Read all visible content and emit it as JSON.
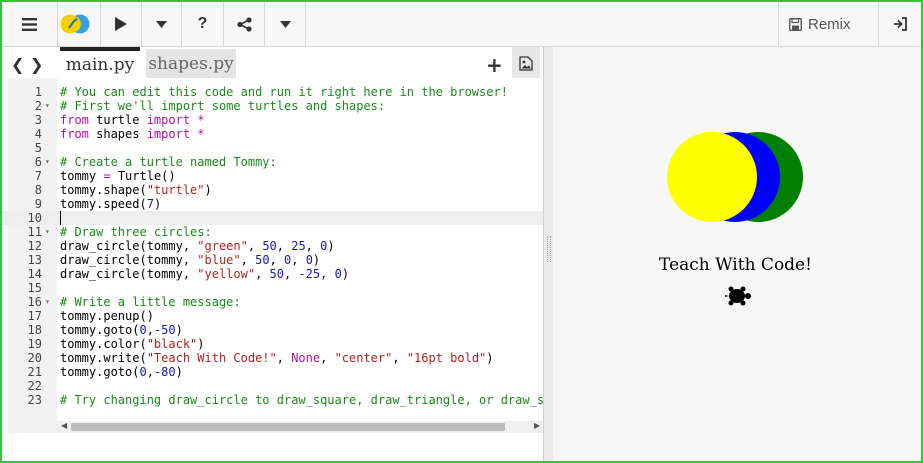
{
  "toolbar": {
    "menu_icon": "hamburger-icon",
    "logo_icon": "python-logo-icon",
    "run_icon": "play-icon",
    "run_dropdown_icon": "caret-down-icon",
    "help_icon": "question-icon",
    "share_icon": "share-icon",
    "share_dropdown_icon": "caret-down-icon",
    "remix_label": "Remix",
    "remix_icon": "save-icon",
    "signin_icon": "sign-in-icon"
  },
  "editor": {
    "tabs": [
      {
        "label": "main.py",
        "active": true
      },
      {
        "label": "shapes.py",
        "active": false
      }
    ],
    "current_line": 10,
    "lines": [
      {
        "num": "1",
        "fold": false,
        "tokens": [
          [
            "c",
            "# You can edit this code and run it right here in the browser!"
          ]
        ]
      },
      {
        "num": "2",
        "fold": true,
        "tokens": [
          [
            "c",
            "# First we'll import some turtles and shapes:"
          ]
        ]
      },
      {
        "num": "3",
        "fold": false,
        "tokens": [
          [
            "k",
            "from"
          ],
          [
            "t",
            " turtle "
          ],
          [
            "k",
            "import"
          ],
          [
            "t",
            " "
          ],
          [
            "k",
            "*"
          ]
        ]
      },
      {
        "num": "4",
        "fold": false,
        "tokens": [
          [
            "k",
            "from"
          ],
          [
            "t",
            " shapes "
          ],
          [
            "k",
            "import"
          ],
          [
            "t",
            " "
          ],
          [
            "k",
            "*"
          ]
        ]
      },
      {
        "num": "5",
        "fold": false,
        "tokens": []
      },
      {
        "num": "6",
        "fold": true,
        "tokens": [
          [
            "c",
            "# Create a turtle named Tommy:"
          ]
        ]
      },
      {
        "num": "7",
        "fold": false,
        "tokens": [
          [
            "t",
            "tommy "
          ],
          [
            "k",
            "="
          ],
          [
            "t",
            " Turtle()"
          ]
        ]
      },
      {
        "num": "8",
        "fold": false,
        "tokens": [
          [
            "t",
            "tommy.shape("
          ],
          [
            "s",
            "\"turtle\""
          ],
          [
            "t",
            ")"
          ]
        ]
      },
      {
        "num": "9",
        "fold": false,
        "tokens": [
          [
            "t",
            "tommy.speed("
          ],
          [
            "n",
            "7"
          ],
          [
            "t",
            ")"
          ]
        ]
      },
      {
        "num": "10",
        "fold": false,
        "tokens": []
      },
      {
        "num": "11",
        "fold": true,
        "tokens": [
          [
            "c",
            "# Draw three circles:"
          ]
        ]
      },
      {
        "num": "12",
        "fold": false,
        "tokens": [
          [
            "t",
            "draw_circle(tommy, "
          ],
          [
            "s",
            "\"green\""
          ],
          [
            "t",
            ", "
          ],
          [
            "n",
            "50"
          ],
          [
            "t",
            ", "
          ],
          [
            "n",
            "25"
          ],
          [
            "t",
            ", "
          ],
          [
            "n",
            "0"
          ],
          [
            "t",
            ")"
          ]
        ]
      },
      {
        "num": "13",
        "fold": false,
        "tokens": [
          [
            "t",
            "draw_circle(tommy, "
          ],
          [
            "s",
            "\"blue\""
          ],
          [
            "t",
            ", "
          ],
          [
            "n",
            "50"
          ],
          [
            "t",
            ", "
          ],
          [
            "n",
            "0"
          ],
          [
            "t",
            ", "
          ],
          [
            "n",
            "0"
          ],
          [
            "t",
            ")"
          ]
        ]
      },
      {
        "num": "14",
        "fold": false,
        "tokens": [
          [
            "t",
            "draw_circle(tommy, "
          ],
          [
            "s",
            "\"yellow\""
          ],
          [
            "t",
            ", "
          ],
          [
            "n",
            "50"
          ],
          [
            "t",
            ", "
          ],
          [
            "n",
            "-25"
          ],
          [
            "t",
            ", "
          ],
          [
            "n",
            "0"
          ],
          [
            "t",
            ")"
          ]
        ]
      },
      {
        "num": "15",
        "fold": false,
        "tokens": []
      },
      {
        "num": "16",
        "fold": true,
        "tokens": [
          [
            "c",
            "# Write a little message:"
          ]
        ]
      },
      {
        "num": "17",
        "fold": false,
        "tokens": [
          [
            "t",
            "tommy.penup()"
          ]
        ]
      },
      {
        "num": "18",
        "fold": false,
        "tokens": [
          [
            "t",
            "tommy.goto("
          ],
          [
            "n",
            "0"
          ],
          [
            "t",
            ","
          ],
          [
            "n",
            "-50"
          ],
          [
            "t",
            ")"
          ]
        ]
      },
      {
        "num": "19",
        "fold": false,
        "tokens": [
          [
            "t",
            "tommy.color("
          ],
          [
            "s",
            "\"black\""
          ],
          [
            "t",
            ")"
          ]
        ]
      },
      {
        "num": "20",
        "fold": false,
        "tokens": [
          [
            "t",
            "tommy.write("
          ],
          [
            "s",
            "\"Teach With Code!\""
          ],
          [
            "t",
            ", "
          ],
          [
            "k",
            "None"
          ],
          [
            "t",
            ", "
          ],
          [
            "s",
            "\"center\""
          ],
          [
            "t",
            ", "
          ],
          [
            "s",
            "\"16pt bold\""
          ],
          [
            "t",
            ")"
          ]
        ]
      },
      {
        "num": "21",
        "fold": false,
        "tokens": [
          [
            "t",
            "tommy.goto("
          ],
          [
            "n",
            "0"
          ],
          [
            "t",
            ","
          ],
          [
            "n",
            "-80"
          ],
          [
            "t",
            ")"
          ]
        ]
      },
      {
        "num": "22",
        "fold": false,
        "tokens": []
      },
      {
        "num": "23",
        "fold": false,
        "tokens": [
          [
            "c",
            "# Try changing draw_circle to draw_square, draw_triangle, or draw_s"
          ]
        ]
      }
    ]
  },
  "output": {
    "message": "Teach With Code!",
    "circle_colors": {
      "green": "#008000",
      "blue": "#0000ff",
      "yellow": "#ffff00"
    },
    "turtle_icon": "turtle-icon"
  }
}
